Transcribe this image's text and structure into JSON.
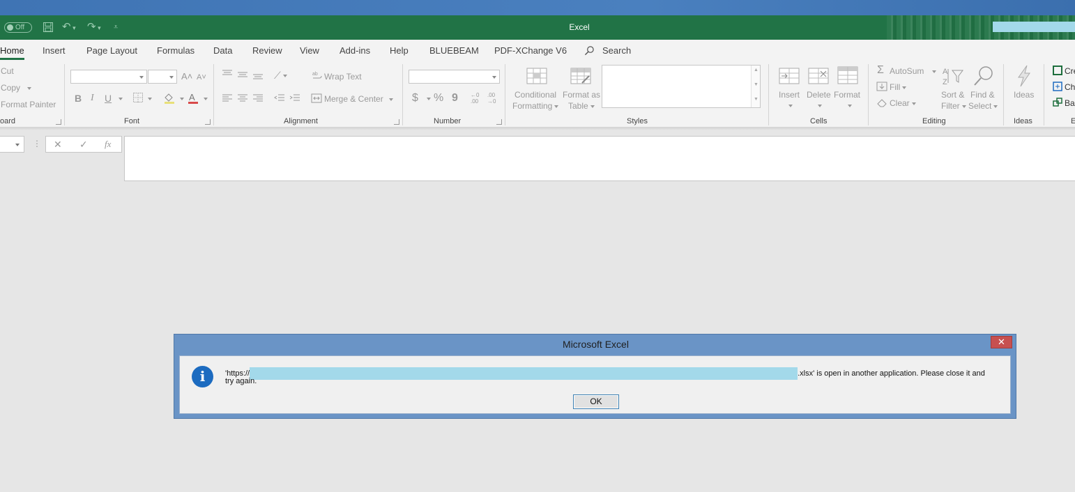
{
  "window": {
    "title": "Excel",
    "autosave_label": "Off"
  },
  "tabs": [
    "Home",
    "Insert",
    "Page Layout",
    "Formulas",
    "Data",
    "Review",
    "View",
    "Add-ins",
    "Help",
    "BLUEBEAM",
    "PDF-XChange V6"
  ],
  "search_label": "Search",
  "ribbon": {
    "clipboard": {
      "cut": "Cut",
      "copy": "Copy",
      "format_painter": "Format Painter",
      "label": "oard"
    },
    "font": {
      "bold": "B",
      "italic": "I",
      "underline": "U",
      "label": "Font"
    },
    "alignment": {
      "wrap_text": "Wrap Text",
      "merge_center": "Merge & Center",
      "label": "Alignment"
    },
    "number": {
      "currency": "$",
      "percent": "%",
      "comma": "9",
      "label": "Number"
    },
    "styles": {
      "conditional_1": "Conditional",
      "conditional_2": "Formatting",
      "format_table_1": "Format as",
      "format_table_2": "Table",
      "label": "Styles"
    },
    "cells": {
      "insert": "Insert",
      "delete": "Delete",
      "format": "Format",
      "label": "Cells"
    },
    "editing": {
      "autosum": "AutoSum",
      "fill": "Fill",
      "clear": "Clear",
      "sort_1": "Sort &",
      "sort_2": "Filter",
      "find_1": "Find &",
      "find_2": "Select",
      "label": "Editing"
    },
    "ideas": {
      "button": "Ideas",
      "label": "Ideas"
    },
    "extra": {
      "item1": "Cre",
      "item2": "Ch",
      "item3": "Ba",
      "label": "E"
    }
  },
  "formula_bar": {
    "fx": "fx"
  },
  "dialog": {
    "title": "Microsoft Excel",
    "close": "✕",
    "message_prefix": "'https://",
    "message_suffix": ".xlsx' is open in another application. Please close it and",
    "message_line2": "try again.",
    "ok_label": "OK"
  },
  "colors": {
    "excel_green": "#217346",
    "dialog_frame": "#6a94c6",
    "close_red": "#c75050",
    "info_blue": "#1c6bc0"
  }
}
